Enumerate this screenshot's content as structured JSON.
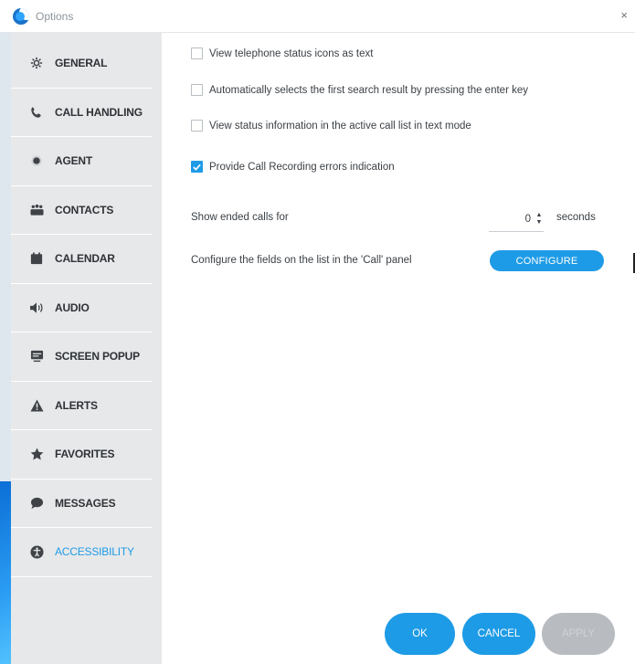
{
  "window": {
    "title": "Options",
    "close_glyph": "×"
  },
  "sidebar": {
    "items": [
      {
        "label": "GENERAL",
        "icon": "gear-icon"
      },
      {
        "label": "CALL HANDLING",
        "icon": "phone-icon"
      },
      {
        "label": "AGENT",
        "icon": "agent-icon"
      },
      {
        "label": "CONTACTS",
        "icon": "contacts-icon"
      },
      {
        "label": "CALENDAR",
        "icon": "calendar-icon"
      },
      {
        "label": "AUDIO",
        "icon": "speaker-icon"
      },
      {
        "label": "SCREEN POPUP",
        "icon": "screen-popup-icon"
      },
      {
        "label": "ALERTS",
        "icon": "alert-icon"
      },
      {
        "label": "FAVORITES",
        "icon": "star-icon"
      },
      {
        "label": "MESSAGES",
        "icon": "message-icon"
      },
      {
        "label": "ACCESSIBILITY",
        "icon": "accessibility-icon",
        "active": true
      }
    ]
  },
  "options": {
    "checkboxes": [
      {
        "label": "View telephone status icons as text",
        "checked": false
      },
      {
        "label": "Automatically selects the first search result by pressing the enter key",
        "checked": false
      },
      {
        "label": "View status information in the active call list in text mode",
        "checked": false
      },
      {
        "label": "Provide Call Recording errors indication",
        "checked": true
      }
    ],
    "ended_calls": {
      "label": "Show ended calls for",
      "value": "0",
      "unit": "seconds"
    },
    "configure": {
      "label": "Configure the fields on the list in the 'Call' panel",
      "button": "CONFIGURE"
    }
  },
  "footer": {
    "ok": "OK",
    "cancel": "CANCEL",
    "apply": "APPLY"
  },
  "colors": {
    "accent": "#1e9be6",
    "sidebar_bg": "#e7e8ea",
    "disabled": "#b8bcc0"
  }
}
